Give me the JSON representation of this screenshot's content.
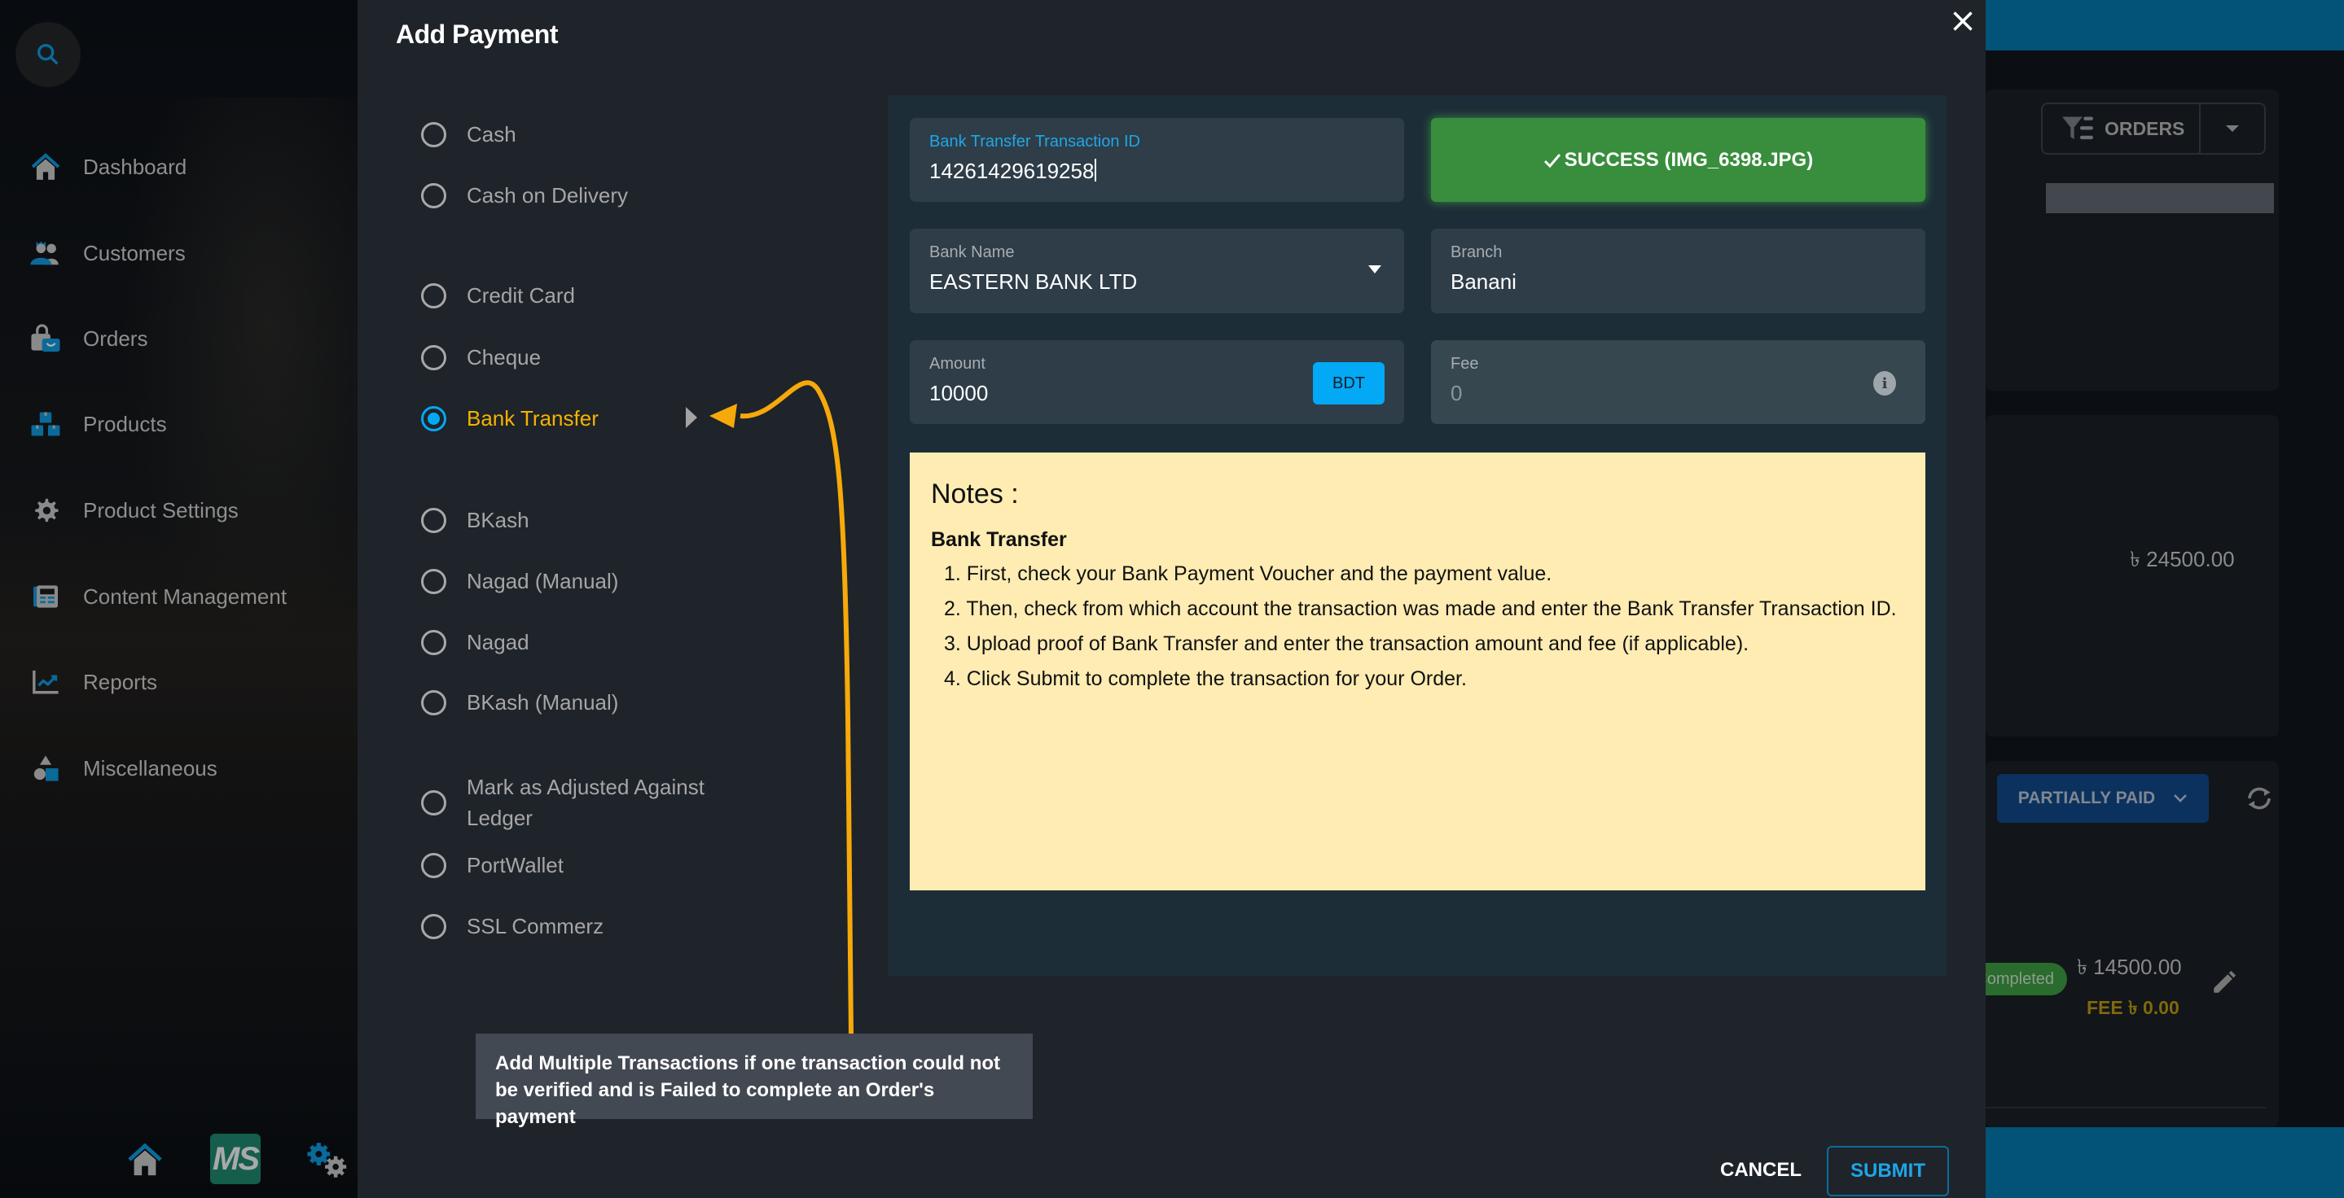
{
  "sidebar": {
    "items": [
      {
        "label": "Dashboard",
        "icon": "home-icon"
      },
      {
        "label": "Customers",
        "icon": "customers-icon"
      },
      {
        "label": "Orders",
        "icon": "orders-bag-icon"
      },
      {
        "label": "Products",
        "icon": "products-boxes-icon"
      },
      {
        "label": "Product Settings",
        "icon": "gear-icon"
      },
      {
        "label": "Content Management",
        "icon": "newspaper-icon"
      },
      {
        "label": "Reports",
        "icon": "chart-icon"
      },
      {
        "label": "Miscellaneous",
        "icon": "shapes-icon"
      }
    ],
    "logo_text": "MS"
  },
  "dialog": {
    "title": "Add Payment",
    "payment_methods": [
      {
        "label": "Cash",
        "selected": false
      },
      {
        "label": "Cash on Delivery",
        "selected": false
      },
      {
        "label": "Credit Card",
        "selected": false
      },
      {
        "label": "Cheque",
        "selected": false
      },
      {
        "label": "Bank Transfer",
        "selected": true
      },
      {
        "label": "BKash",
        "selected": false
      },
      {
        "label": "Nagad (Manual)",
        "selected": false
      },
      {
        "label": "Nagad",
        "selected": false
      },
      {
        "label": "BKash (Manual)",
        "selected": false
      },
      {
        "label": "Mark as Adjusted Against Ledger",
        "selected": false
      },
      {
        "label": "PortWallet",
        "selected": false
      },
      {
        "label": "SSL Commerz",
        "selected": false
      }
    ],
    "form": {
      "transaction_id": {
        "label": "Bank Transfer Transaction ID",
        "value": "14261429619258"
      },
      "upload_status": "SUCCESS (IMG_6398.JPG)",
      "bank_name": {
        "label": "Bank Name",
        "value": "EASTERN BANK LTD"
      },
      "branch": {
        "label": "Branch",
        "value": "Banani"
      },
      "amount": {
        "label": "Amount",
        "value": "10000",
        "currency": "BDT"
      },
      "fee": {
        "label": "Fee",
        "value": "0"
      }
    },
    "notes": {
      "heading": "Notes :",
      "subheading": "Bank Transfer",
      "items": [
        "1. First, check your Bank Payment Voucher and the payment value.",
        "2. Then, check from which account the transaction was made and enter the Bank Transfer Transaction ID.",
        "3. Upload proof of Bank Transfer and enter the transaction amount and fee (if applicable).",
        "4. Click Submit to complete the transaction for your Order."
      ]
    },
    "tooltip": "Add Multiple Transactions if one transaction could not be verified and is Failed to complete an Order's payment",
    "cancel_label": "CANCEL",
    "submit_label": "SUBMIT"
  },
  "background_page": {
    "orders_button": "ORDERS",
    "total_amount": "৳ 24500.00",
    "payment_status": "PARTIALLY PAID",
    "transaction_status": "Completed",
    "transaction_amount": "৳ 14500.00",
    "transaction_fee": "FEE ৳ 0.00"
  },
  "colors": {
    "accent": "#03a9f4",
    "selected_method": "#f5b300",
    "success": "#388e3c",
    "notes_bg": "#ffecb3",
    "annotation_arrow": "#f5a90a"
  }
}
